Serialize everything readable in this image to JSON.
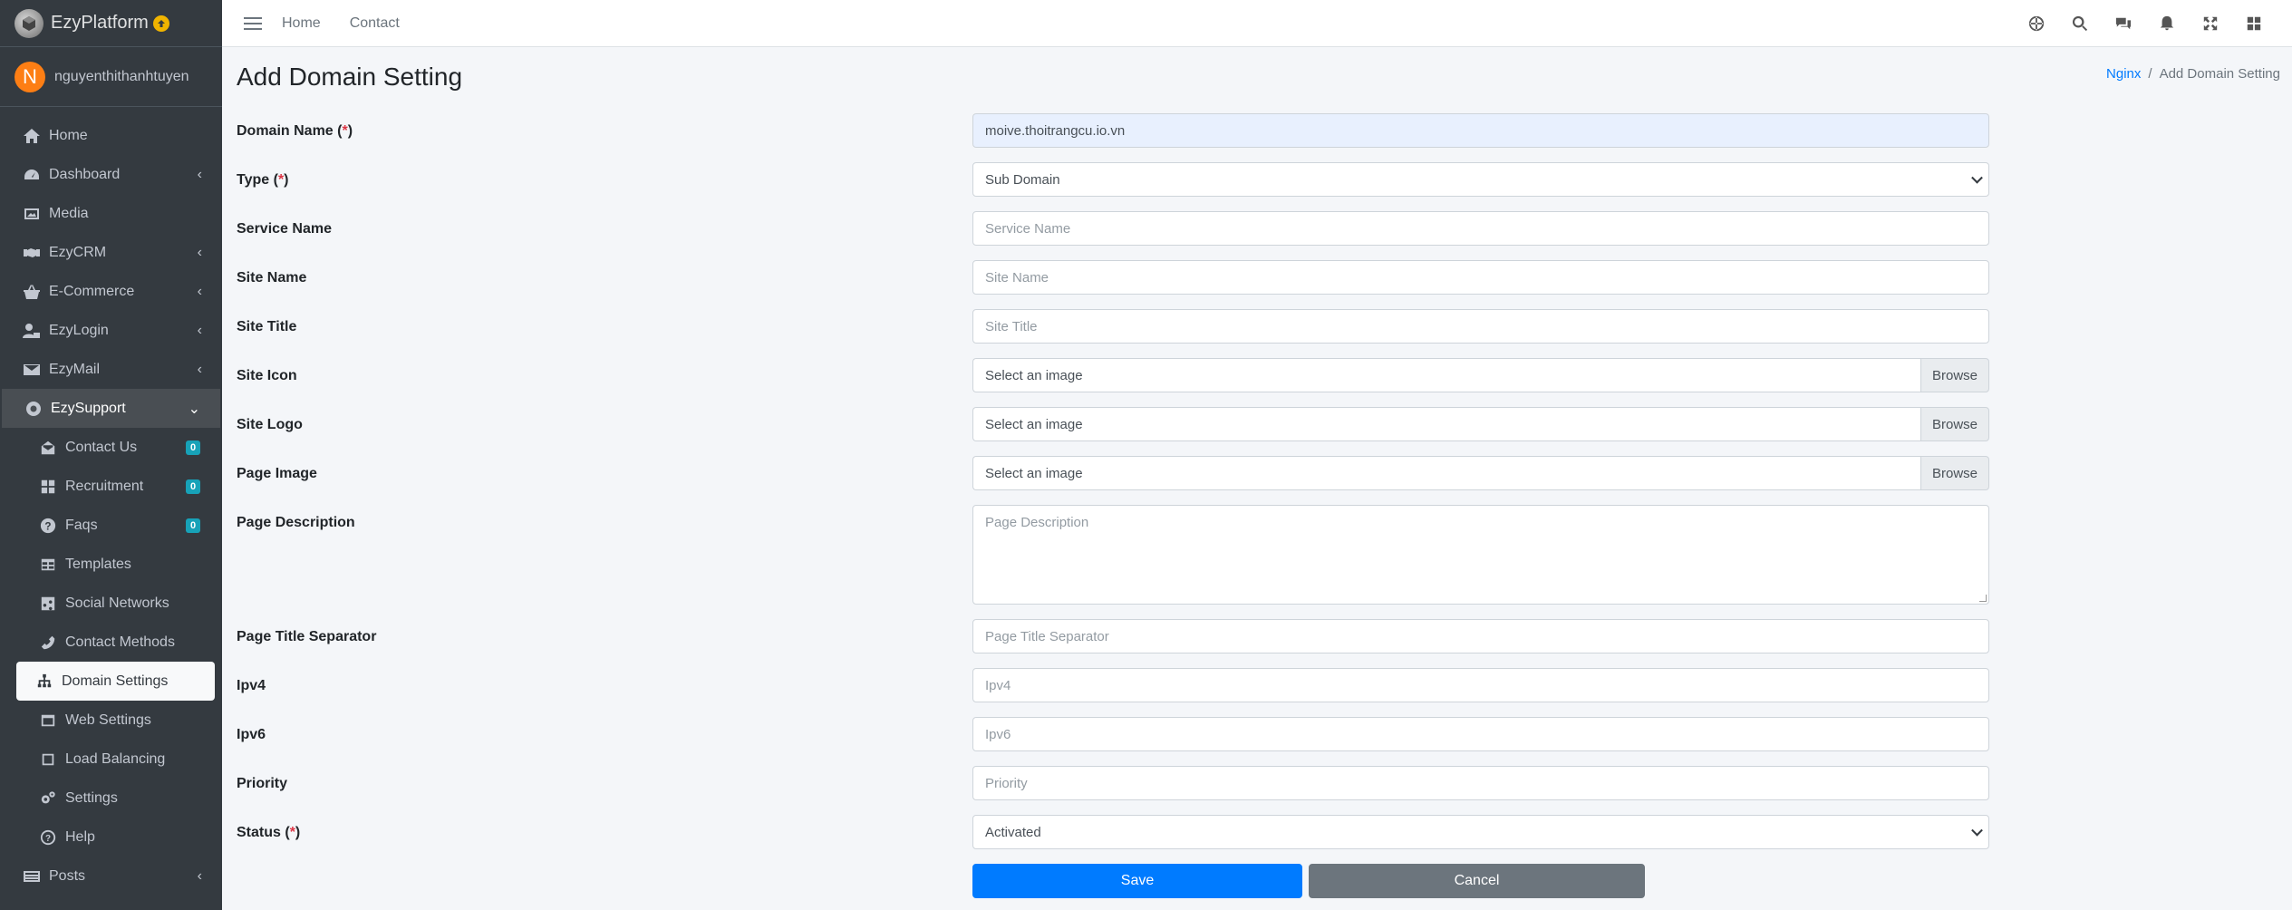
{
  "brand": {
    "name": "EzyPlatform",
    "logo_icon": "platform-logo-icon",
    "badge_icon": "upload-circle-icon"
  },
  "user": {
    "initial": "N",
    "name": "nguyenthithanhtuyen"
  },
  "sidebar": {
    "items": [
      {
        "label": "Home",
        "icon": "home-icon"
      },
      {
        "label": "Dashboard",
        "icon": "dashboard-icon",
        "caret": "‹"
      },
      {
        "label": "Media",
        "icon": "image-icon"
      },
      {
        "label": "EzyCRM",
        "icon": "handshake-icon",
        "caret": "‹"
      },
      {
        "label": "E-Commerce",
        "icon": "basket-icon",
        "caret": "‹"
      },
      {
        "label": "EzyLogin",
        "icon": "user-lock-icon",
        "caret": "‹"
      },
      {
        "label": "EzyMail",
        "icon": "envelope-icon",
        "caret": "‹"
      },
      {
        "label": "EzySupport",
        "icon": "support-icon",
        "caret": "⌄"
      }
    ],
    "sub_items": [
      {
        "label": "Contact Us",
        "icon": "envelope-open-icon",
        "badge": "0"
      },
      {
        "label": "Recruitment",
        "icon": "th-large-icon",
        "badge": "0"
      },
      {
        "label": "Faqs",
        "icon": "question-circle-icon",
        "badge": "0"
      },
      {
        "label": "Templates",
        "icon": "table-icon"
      },
      {
        "label": "Social Networks",
        "icon": "share-square-icon"
      },
      {
        "label": "Contact Methods",
        "icon": "phone-icon"
      },
      {
        "label": "Domain Settings",
        "icon": "sitemap-icon"
      },
      {
        "label": "Web Settings",
        "icon": "window-icon"
      },
      {
        "label": "Load Balancing",
        "icon": "square-icon"
      },
      {
        "label": "Settings",
        "icon": "cogs-icon"
      },
      {
        "label": "Help",
        "icon": "question-circle-outline-icon"
      }
    ],
    "posts": {
      "label": "Posts",
      "icon": "newspaper-icon",
      "caret": "‹"
    }
  },
  "topbar": {
    "links": [
      "Home",
      "Contact"
    ],
    "icons": [
      "globe-icon",
      "search-icon",
      "comments-icon",
      "bell-icon",
      "expand-icon",
      "grid-icon"
    ]
  },
  "page": {
    "title": "Add Domain Setting",
    "breadcrumb": {
      "parent": "Nginx",
      "separator": "/",
      "current": "Add Domain Setting"
    }
  },
  "form": {
    "required_mark": "*",
    "domain_name": {
      "label": "Domain Name",
      "value": "moive.thoitrangcu.io.vn"
    },
    "type": {
      "label": "Type",
      "value": "Sub Domain"
    },
    "service_name": {
      "label": "Service Name",
      "placeholder": "Service Name"
    },
    "site_name": {
      "label": "Site Name",
      "placeholder": "Site Name"
    },
    "site_title": {
      "label": "Site Title",
      "placeholder": "Site Title"
    },
    "site_icon": {
      "label": "Site Icon",
      "placeholder": "Select an image",
      "browse": "Browse"
    },
    "site_logo": {
      "label": "Site Logo",
      "placeholder": "Select an image",
      "browse": "Browse"
    },
    "page_image": {
      "label": "Page Image",
      "placeholder": "Select an image",
      "browse": "Browse"
    },
    "page_description": {
      "label": "Page Description",
      "placeholder": "Page Description"
    },
    "page_title_separator": {
      "label": "Page Title Separator",
      "placeholder": "Page Title Separator"
    },
    "ipv4": {
      "label": "Ipv4",
      "placeholder": "Ipv4"
    },
    "ipv6": {
      "label": "Ipv6",
      "placeholder": "Ipv6"
    },
    "priority": {
      "label": "Priority",
      "placeholder": "Priority"
    },
    "status": {
      "label": "Status",
      "value": "Activated"
    },
    "save_label": "Save",
    "cancel_label": "Cancel"
  }
}
